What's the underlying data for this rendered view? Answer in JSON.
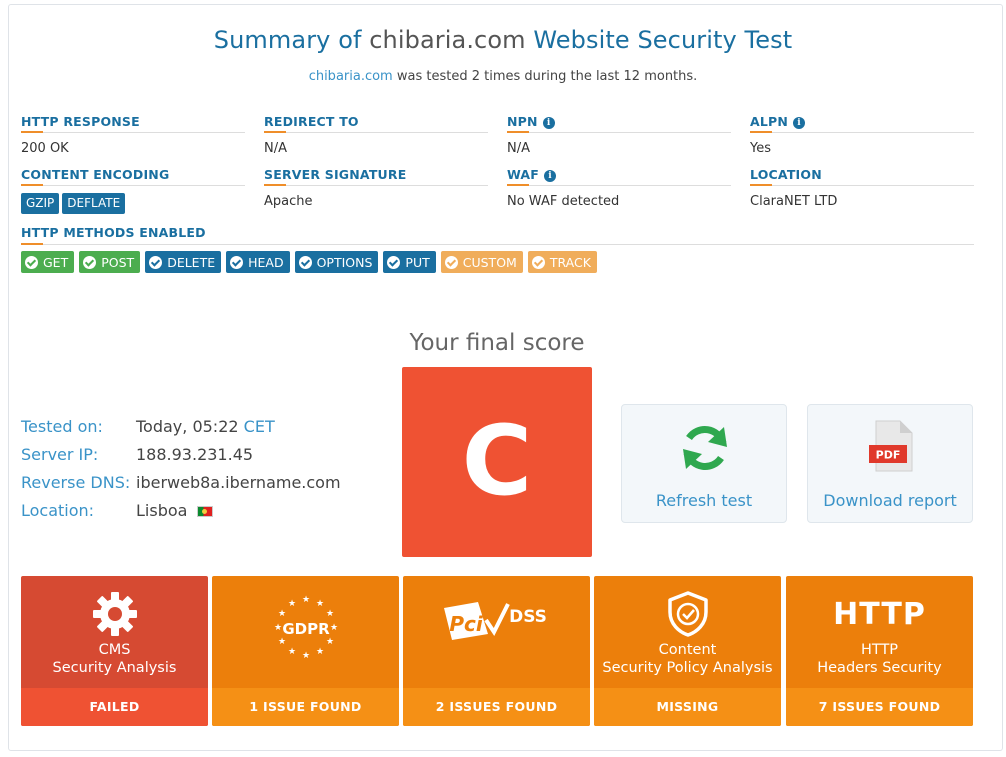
{
  "header": {
    "title_prefix": "Summary of",
    "title_domain": "chibaria.com",
    "title_suffix": "Website Security Test",
    "subtitle_link": "chibaria.com",
    "subtitle_text": "was tested 2 times during the last 12 months."
  },
  "fields": {
    "http_response": {
      "label": "HTTP RESPONSE",
      "value": "200 OK"
    },
    "redirect_to": {
      "label": "REDIRECT TO",
      "value": "N/A"
    },
    "npn": {
      "label": "NPN",
      "value": "N/A"
    },
    "alpn": {
      "label": "ALPN",
      "value": "Yes"
    },
    "content_encoding": {
      "label": "CONTENT ENCODING",
      "tags": [
        "GZIP",
        "DEFLATE"
      ]
    },
    "server_signature": {
      "label": "SERVER SIGNATURE",
      "value": "Apache"
    },
    "waf": {
      "label": "WAF",
      "value": "No WAF detected"
    },
    "location": {
      "label": "LOCATION",
      "value": "ClaraNET LTD"
    }
  },
  "methods": {
    "label": "HTTP METHODS ENABLED",
    "items": [
      "GET",
      "POST",
      "DELETE",
      "HEAD",
      "OPTIONS",
      "PUT",
      "CUSTOM",
      "TRACK"
    ],
    "colors": {
      "green": "#4cad4f",
      "blue": "#1a6fa0",
      "orange": "#f0ad5b"
    }
  },
  "score": {
    "label": "Your final score",
    "grade": "C",
    "color": "#ef5233"
  },
  "info": {
    "tested_on_label": "Tested on:",
    "tested_on_value": "Today, 05:22",
    "tested_on_tz": "CET",
    "server_ip_label": "Server IP:",
    "server_ip_value": "188.93.231.45",
    "reverse_dns_label": "Reverse DNS:",
    "reverse_dns_value": "iberweb8a.ibername.com",
    "location_label": "Location:",
    "location_value": "Lisboa",
    "flag_icon": "portugal-flag-icon"
  },
  "actions": {
    "refresh": "Refresh test",
    "download": "Download report",
    "pdf_badge": "PDF"
  },
  "tiles": [
    {
      "line1": "CMS",
      "line2": "Security Analysis",
      "status": "FAILED",
      "icon": "gear-icon"
    },
    {
      "icon_text": "GDPR",
      "status": "1 ISSUE FOUND",
      "icon": "gdpr-stars-icon"
    },
    {
      "icon_text": "DSS",
      "status": "2 ISSUES FOUND",
      "icon": "pci-dss-icon"
    },
    {
      "line1": "Content",
      "line2": "Security Policy Analysis",
      "status": "MISSING",
      "icon": "shield-check-icon"
    },
    {
      "icon_text": "HTTP",
      "line1": "HTTP",
      "line2": "Headers Security",
      "status": "7 ISSUES FOUND",
      "icon": "http-text-icon"
    }
  ]
}
